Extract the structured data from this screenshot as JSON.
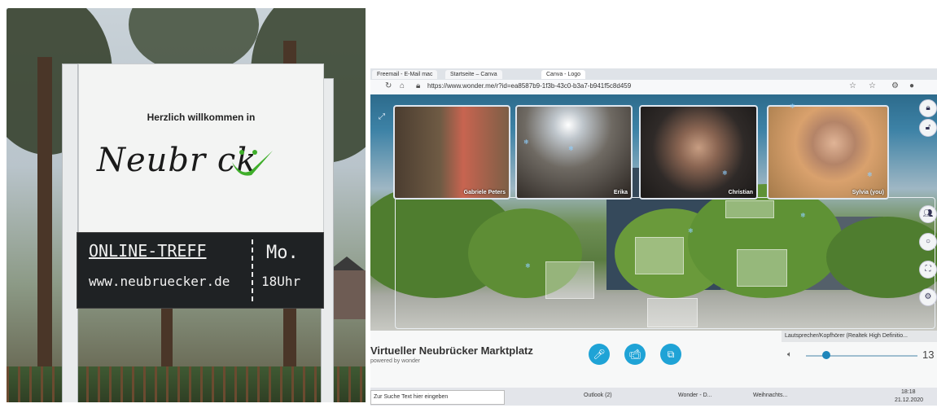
{
  "sign": {
    "welcome": "Herzlich willkommen in",
    "town_name": "Neubr  ck",
    "board_line1": "ONLINE-TREFF",
    "board_line2": "www.neubruecker.de",
    "board_day": "Mo.",
    "board_time": "18Uhr"
  },
  "browser": {
    "tabs": [
      "Freemail - E-Mail mac",
      "Startseite – Canva",
      "Canva - Logo"
    ],
    "url": "https://www.wonder.me/r?id=ea8587b9-1f3b-43c0-b3a7-b941f5c8d459"
  },
  "participants": [
    "Gabriele Peters",
    "Erika",
    "Christian",
    "Sylvia (you)"
  ],
  "room": {
    "title": "Virtueller Neubrücker Marktplatz",
    "subtitle": "powered by wonder",
    "audio_device": "Lautsprecher/Kopfhörer (Realtek High Definitio...",
    "volume": "13"
  },
  "taskbar": {
    "search_placeholder": "Zur Suche Text hier eingeben",
    "items": [
      "Outlook (2)",
      "Wonder - D...",
      "Weihnachts..."
    ],
    "time": "18:18",
    "date": "21.12.2020"
  },
  "colors": {
    "accent": "#1fa3d6",
    "check": "#3fae2a"
  }
}
